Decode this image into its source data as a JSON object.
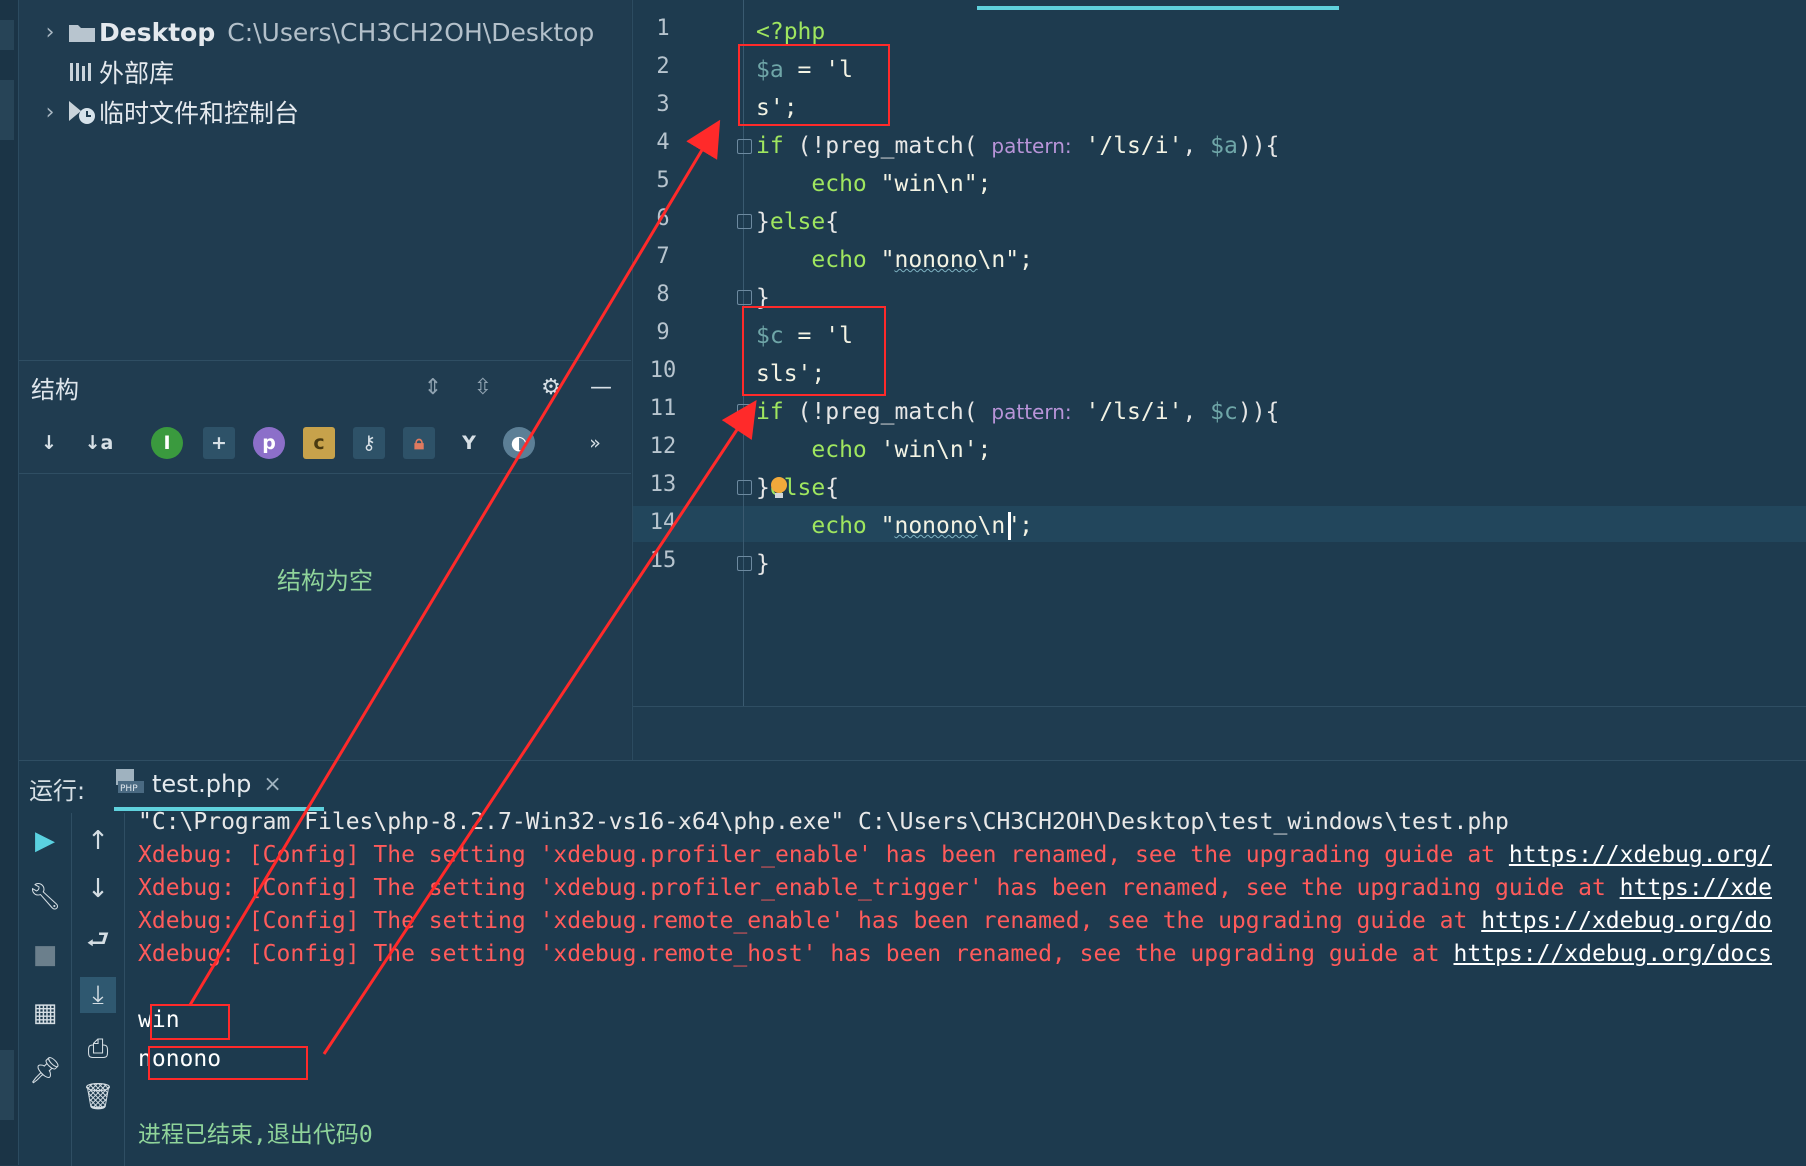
{
  "project_tree": {
    "items": [
      {
        "label": "Desktop",
        "path": "C:\\Users\\CH3CH2OH\\Desktop",
        "icon": "folder-icon"
      },
      {
        "label": "外部库",
        "icon": "library-icon"
      },
      {
        "label": "临时文件和控制台",
        "icon": "scratches-icon"
      }
    ]
  },
  "structure": {
    "title": "结构",
    "empty_text": "结构为空",
    "toolbar": {
      "sort_visibility": "↓",
      "sort_alpha": "↓a",
      "inherited": "I",
      "fields": "+",
      "properties": "p",
      "constants": "c",
      "more": "»"
    }
  },
  "editor": {
    "line_numbers": [
      "1",
      "2",
      "3",
      "4",
      "5",
      "6",
      "7",
      "8",
      "9",
      "10",
      "11",
      "12",
      "13",
      "14",
      "15"
    ],
    "code": {
      "l1": "<?php",
      "l2_var": "$a",
      "l2_rest": " = 'l",
      "l3": "s';",
      "l4_kw": "if",
      "l4_a": " (!preg_match( ",
      "l4_hint": "pattern:",
      "l4_str": " '/ls/i'",
      "l4_b": ", ",
      "l4_var": "$a",
      "l4_c": ")){",
      "l5_kw": "    echo",
      "l5_str": " \"win\\n\";",
      "l6_a": "}",
      "l6_kw": "else",
      "l6_b": "{",
      "l7_kw": "    echo",
      "l7_q": " \"",
      "l7_sq": "nonono",
      "l7_rest": "\\n\";",
      "l8": "}",
      "l9_var": "$c",
      "l9_rest": " = 'l",
      "l10": "sls';",
      "l11_kw": "if",
      "l11_a": " (!preg_match( ",
      "l11_hint": "pattern:",
      "l11_str": " '/ls/i'",
      "l11_b": ", ",
      "l11_var": "$c",
      "l11_c": ")){",
      "l12_kw": "    echo",
      "l12_str": " 'win\\n';",
      "l13_a": "}",
      "l13_kw": "else",
      "l13_b": "{",
      "l14_kw": "    echo",
      "l14_q": " \"",
      "l14_sq": "nonono",
      "l14_rest": "\\n\";",
      "l15": "}"
    }
  },
  "run": {
    "title": "运行:",
    "tab_label": "test.php",
    "tab_close": "×",
    "console": {
      "cmd": "\"C:\\Program Files\\php-8.2.7-Win32-vs16-x64\\php.exe\" C:\\Users\\CH3CH2OH\\Desktop\\test_windows\\test.php",
      "err1": "Xdebug: [Config] The setting 'xdebug.profiler_enable' has been renamed, see the upgrading guide at ",
      "err1_link": "https://xdebug.org/",
      "err2": "Xdebug: [Config] The setting 'xdebug.profiler_enable_trigger' has been renamed, see the upgrading guide at ",
      "err2_link": "https://xde",
      "err3": "Xdebug: [Config] The setting 'xdebug.remote_enable' has been renamed, see the upgrading guide at ",
      "err3_link": "https://xdebug.org/do",
      "err4": "Xdebug: [Config] The setting 'xdebug.remote_host' has been renamed, see the upgrading guide at ",
      "err4_link": "https://xdebug.org/docs",
      "out1": "win",
      "out2": "nonono",
      "exit": "进程已结束,退出代码0"
    }
  },
  "colors": {
    "accent": "#5fd1dd",
    "annotation": "#ff2a2a",
    "keyword": "#9fe65f",
    "error": "#ff5b5b"
  }
}
